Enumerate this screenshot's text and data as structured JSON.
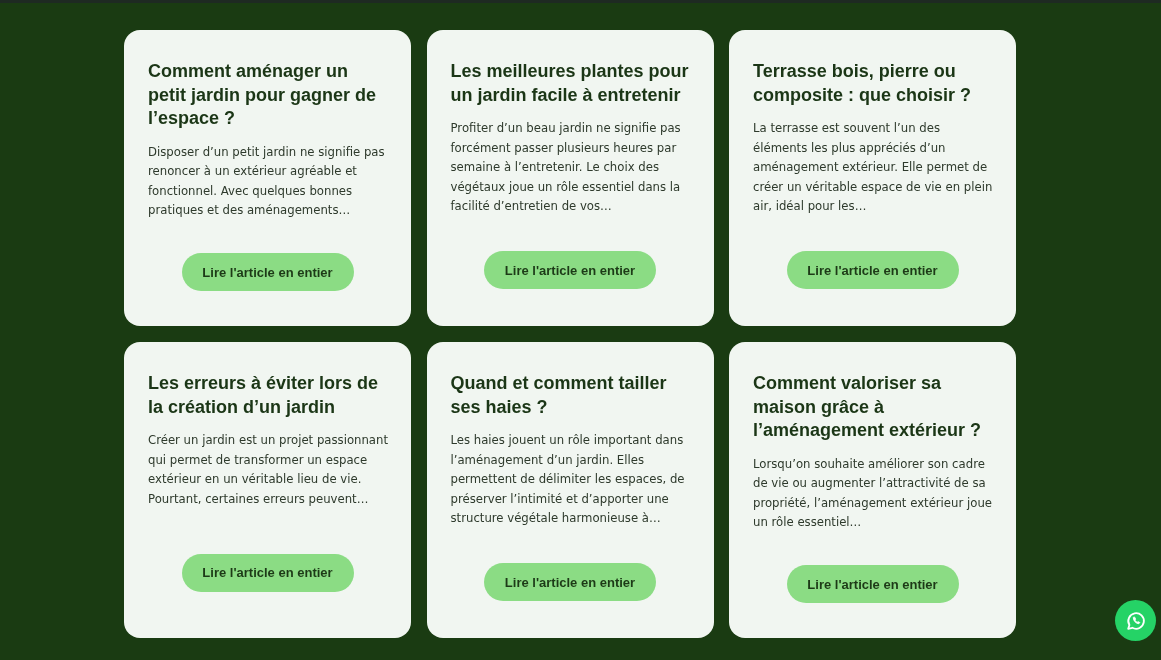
{
  "articles": [
    {
      "title": "Comment aménager un petit jardin pour gagner de l’espace ?",
      "excerpt": "Disposer d’un petit jardin ne signifie pas renoncer à un extérieur agréable et fonctionnel. Avec quelques bonnes pratiques et des aménagements…",
      "button": "Lire l'article en entier"
    },
    {
      "title": "Les meilleures plantes pour un jardin facile à entretenir",
      "excerpt": "Profiter d’un beau jardin ne signifie pas forcément passer plusieurs heures par semaine à l’entretenir. Le choix des végétaux joue un rôle essentiel dans la facilité d’entretien de vos…",
      "button": "Lire l'article en entier"
    },
    {
      "title": "Terrasse bois, pierre ou composite : que choisir ?",
      "excerpt": "La terrasse est souvent l’un des éléments les plus appréciés d’un aménagement extérieur. Elle permet de créer un véritable espace de vie en plein air, idéal pour les…",
      "button": "Lire l'article en entier"
    },
    {
      "title": "Les erreurs à éviter lors de la création d’un jardin",
      "excerpt": "Créer un jardin est un projet passionnant qui permet de transformer un espace extérieur en un véritable lieu de vie. Pourtant, certaines erreurs peuvent…",
      "button": "Lire l'article en entier"
    },
    {
      "title": "Quand et comment tailler ses haies ?",
      "excerpt": "Les haies jouent un rôle important dans l’aménagement d’un jardin. Elles permettent de délimiter les espaces, de préserver l’intimité et d’apporter une structure végétale harmonieuse à…",
      "button": "Lire l'article en entier"
    },
    {
      "title": "Comment valoriser sa maison grâce à l’aménagement extérieur ?",
      "excerpt": "Lorsqu’on souhaite améliorer son cadre de vie ou augmenter l’attractivité de sa propriété, l’aménagement extérieur joue un rôle essentiel…",
      "button": "Lire l'article en entier"
    }
  ]
}
